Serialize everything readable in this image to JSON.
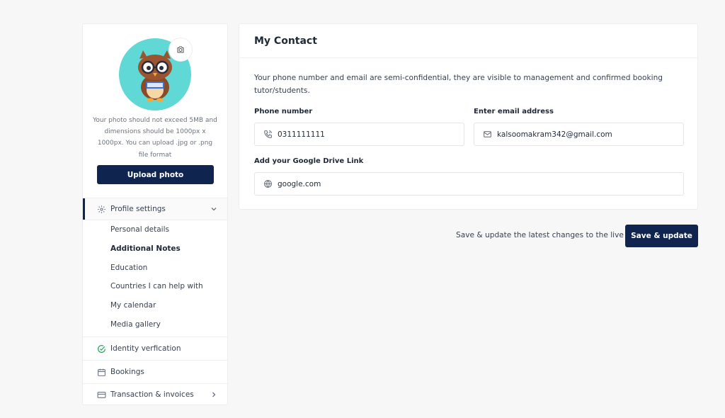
{
  "sidebar": {
    "photo_note": "Your photo should not exceed 5MB and dimensions should be 1000px x 1000px. You can upload .jpg or .png file format",
    "upload_label": "Upload photo",
    "profile_settings": "Profile settings",
    "sub_items": [
      "Personal details",
      "Additional Notes",
      "Education",
      "Countries I can help with",
      "My calendar",
      "Media gallery"
    ],
    "active_sub_item": "Additional Notes",
    "identity": "Identity verfication",
    "bookings": "Bookings",
    "transactions": "Transaction & invoices",
    "icons": {
      "camera": "camera-icon",
      "profile": "gear-icon",
      "identity": "check-circle-icon",
      "bookings": "calendar-icon",
      "transactions": "credit-card-icon"
    }
  },
  "contact": {
    "title": "My Contact",
    "description": "Your phone number and email are semi-confidential, they are visible to management and confirmed booking tutor/students.",
    "phone_label": "Phone number",
    "phone_value": "0311111111",
    "email_label": "Enter email address",
    "email_value": "kalsoomakram342@gmail.com",
    "drive_label": "Add your Google Drive Link",
    "drive_value": "google.com"
  },
  "footer": {
    "save_note": "Save & update the latest changes to the live",
    "save_label": "Save & update"
  },
  "colors": {
    "primary": "#0f2550",
    "avatar_bg": "#5fd8d6",
    "success": "#22a559"
  }
}
